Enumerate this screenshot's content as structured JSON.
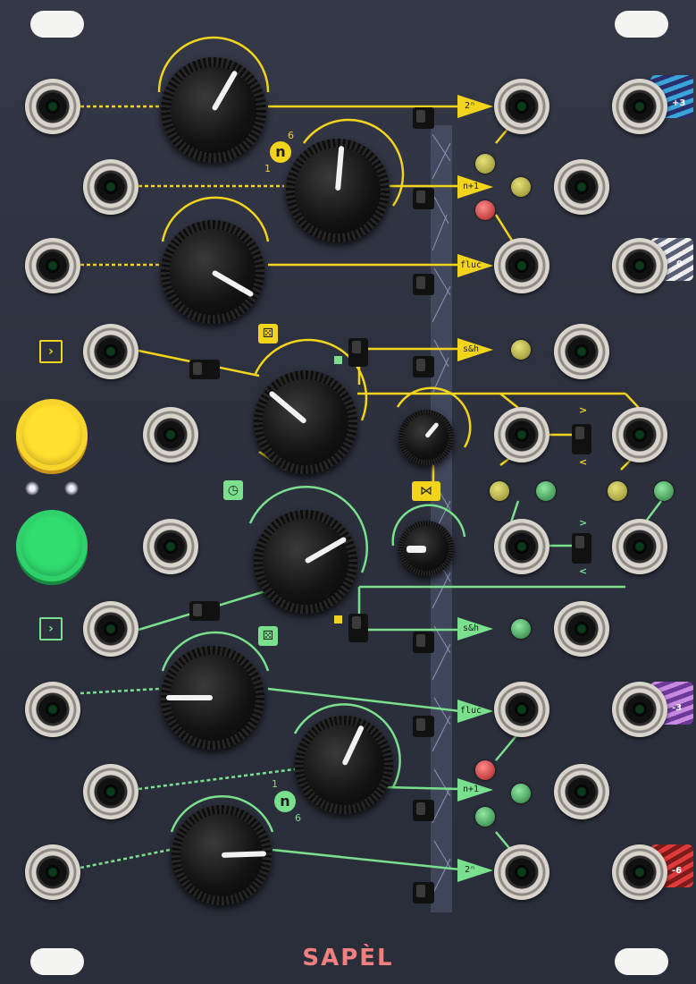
{
  "brand": "SAPÈL",
  "colors": {
    "yellow": "#f2d41d",
    "green": "#7ae08e",
    "red": "#e35a5a",
    "panel": "#30343f"
  },
  "labels": {
    "top_2n": "2ⁿ",
    "top_n1": "n+1",
    "top_fluc": "fluc",
    "top_sh": "s&h",
    "bot_sh": "s&h",
    "bot_fluc": "fluc",
    "bot_n1": "n+1",
    "bot_2n": "2ⁿ"
  },
  "badges": {
    "top_n": "n",
    "top_n_min": "1",
    "top_n_max": "6",
    "bot_n": "n",
    "bot_n_min": "1",
    "bot_n_max": "6"
  },
  "compare": {
    "gt_top": ">",
    "lt_top": "<",
    "gt_bot": ">",
    "lt_bot": "<"
  },
  "outputs_right": {
    "plus3": "+3",
    "zero": "0",
    "minus3": "-3",
    "minus6": "-6"
  },
  "icons": {
    "gate_in_top": "chevron-right-icon",
    "gate_in_bot": "chevron-right-icon",
    "dice_top": "dice-icon",
    "dice_bot": "dice-icon",
    "clock": "clock-icon",
    "xor": "crossfade-icon"
  },
  "arrow_chars": {
    "gate": "›",
    "dice": "⚄",
    "clock": "◷",
    "xfade": "⋈"
  }
}
